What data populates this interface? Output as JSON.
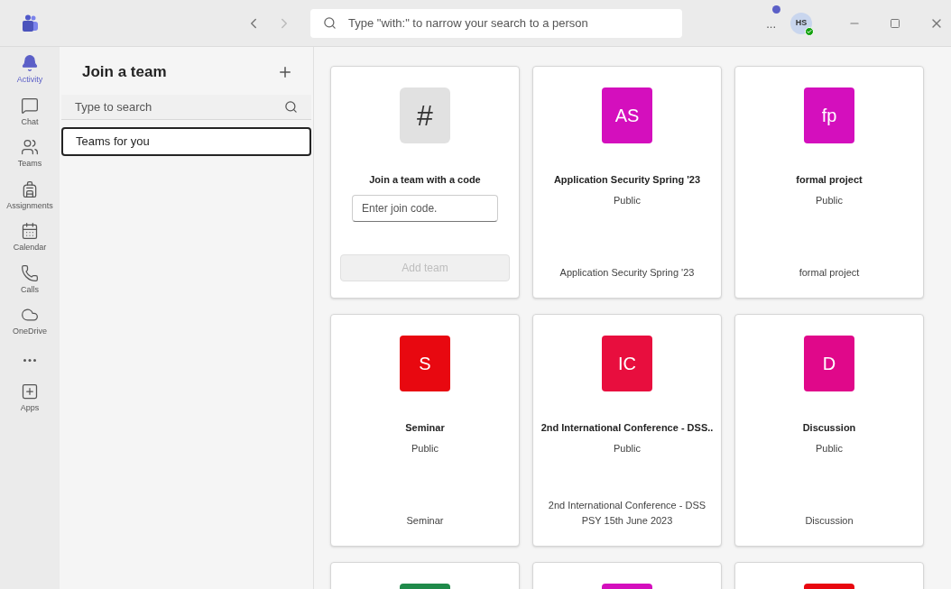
{
  "top_bar": {
    "search": {
      "placeholder": "Type \"with:\" to narrow your search to a person"
    },
    "more": "...",
    "avatar": {
      "initials": "HS",
      "online": true
    },
    "notification_dot": true
  },
  "rail": [
    {
      "label": "Activity",
      "kind": "activity",
      "selected": true
    },
    {
      "label": "Chat",
      "kind": "chat",
      "selected": false
    },
    {
      "label": "Teams",
      "kind": "teams",
      "selected": false
    },
    {
      "label": "Assignments",
      "kind": "assignments",
      "selected": false
    },
    {
      "label": "Calendar",
      "kind": "calendar",
      "selected": false
    },
    {
      "label": "Calls",
      "kind": "calls",
      "selected": false
    },
    {
      "label": "OneDrive",
      "kind": "onedrive",
      "selected": false
    },
    {
      "kind": "more",
      "selected": false
    },
    {
      "label": "Apps",
      "kind": "apps",
      "selected": false
    }
  ],
  "panel": {
    "title": "Join a team",
    "search": {
      "placeholder": "Type to search"
    },
    "items": [
      {
        "label": "Teams for you",
        "selected": true
      }
    ]
  },
  "join_card": {
    "symbol": "#",
    "title": "Join a team with a code",
    "field": {
      "placeholder": "Enter join code."
    },
    "button": {
      "label": "Add team",
      "disabled": true
    }
  },
  "teams": [
    {
      "initials": "AS",
      "color": "#d40fbd",
      "name": "Application Security Spring '23",
      "visibility": "Public",
      "description": "Application Security Spring '23"
    },
    {
      "initials": "fp",
      "color": "#d40fbd",
      "name": "formal project",
      "visibility": "Public",
      "description": "formal project"
    },
    {
      "initials": "S",
      "color": "#e80810",
      "name": "Seminar",
      "visibility": "Public",
      "description": "Seminar"
    },
    {
      "initials": "IC",
      "color": "#e80e3e",
      "name": "2nd International Conference - DSS..",
      "visibility": "Public",
      "description": "2nd International Conference - DSS PSY 15th June 2023"
    },
    {
      "initials": "D",
      "color": "#e0088a",
      "name": "Discussion",
      "visibility": "Public",
      "description": "Discussion"
    },
    {
      "color": "#1f8a4a"
    },
    {
      "color": "#d40fbd"
    },
    {
      "color": "#e80810"
    }
  ]
}
